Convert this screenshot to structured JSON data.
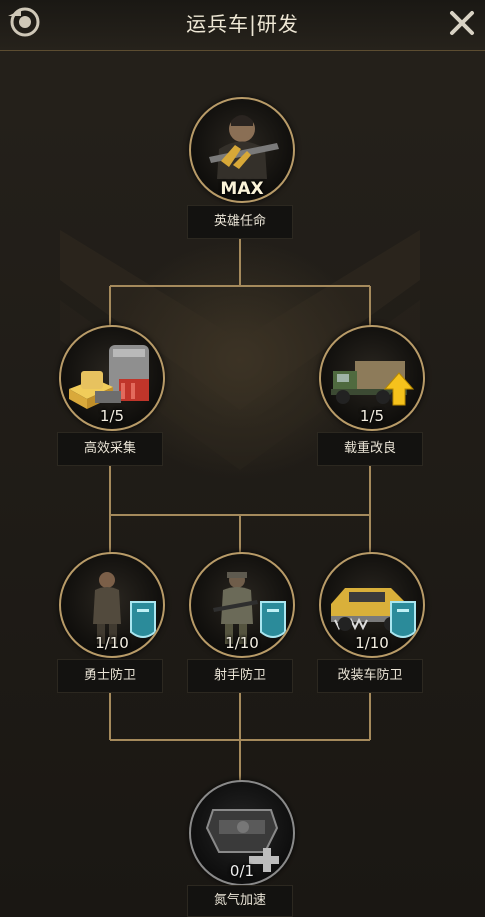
{
  "header": {
    "title": "运兵车|研发",
    "back_icon": "back-arrow-icon",
    "close_icon": "close-icon"
  },
  "tree": {
    "top": {
      "name": "英雄任命",
      "level": "MAX"
    },
    "row2": [
      {
        "name": "高效采集",
        "level": "1/5"
      },
      {
        "name": "载重改良",
        "level": "1/5"
      }
    ],
    "row3": [
      {
        "name": "勇士防卫",
        "level": "1/10"
      },
      {
        "name": "射手防卫",
        "level": "1/10"
      },
      {
        "name": "改装车防卫",
        "level": "1/10"
      }
    ],
    "bottom": {
      "name": "氮气加速",
      "level": "0/1",
      "locked": true
    }
  },
  "colors": {
    "accent_gold": "#b89b68",
    "line_gold": "#a58a5c",
    "background": "#1d1a15"
  }
}
